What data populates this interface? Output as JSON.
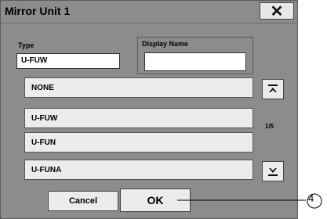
{
  "dialog": {
    "title": "Mirror Unit  1",
    "close_label": "✕"
  },
  "fields": {
    "type_label": "Type",
    "type_value": "U-FUW",
    "display_name_label": "Display Name",
    "display_name_value": ""
  },
  "list": {
    "items": [
      "NONE",
      "U-FUW",
      "U-FUN",
      "U-FUNA"
    ],
    "page_indicator": "1/5"
  },
  "buttons": {
    "cancel_label": "Cancel",
    "ok_label": "OK"
  },
  "callout": {
    "number": "④"
  },
  "colors": {
    "dialog_bg": "#8c8c8c",
    "button_bg": "#ececec",
    "border": "#444444"
  }
}
